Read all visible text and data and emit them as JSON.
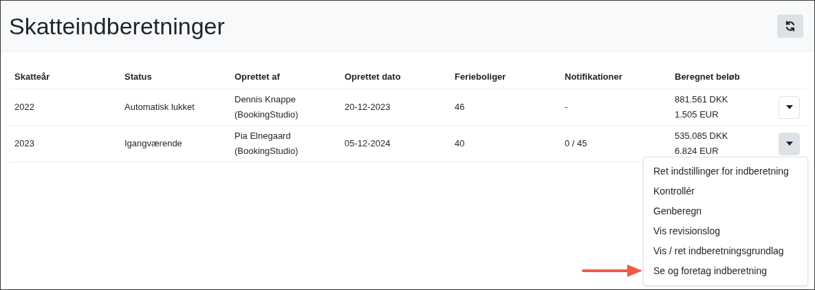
{
  "header": {
    "title": "Skatteindberetninger"
  },
  "table": {
    "columns": [
      "Skatteår",
      "Status",
      "Oprettet af",
      "Oprettet dato",
      "Ferieboliger",
      "Notifikationer",
      "Beregnet beløb"
    ],
    "rows": [
      {
        "cells": [
          "2022",
          "Automatisk lukket",
          [
            "Dennis Knappe",
            "(BookingStudio)"
          ],
          "20-12-2023",
          "46",
          "-",
          [
            "881.561 DKK",
            "1.505 EUR"
          ]
        ],
        "menu_open": false
      },
      {
        "cells": [
          "2023",
          "Igangværende",
          [
            "Pia Elnegaard",
            "(BookingStudio)"
          ],
          "05-12-2024",
          "40",
          "0 / 45",
          [
            "535.085 DKK",
            "6.824 EUR"
          ]
        ],
        "menu_open": true
      }
    ]
  },
  "menu": {
    "items": [
      {
        "label": "Ret indstillinger for indberetning",
        "arrow_pointed": false
      },
      {
        "label": "Kontrollér",
        "arrow_pointed": false
      },
      {
        "label": "Genberegn",
        "arrow_pointed": false
      },
      {
        "label": "Vis revisionslog",
        "arrow_pointed": false
      },
      {
        "label": "Vis / ret indberetningsgrundlag",
        "arrow_pointed": false
      },
      {
        "label": "Se og foretag indberetning",
        "arrow_pointed": true
      }
    ]
  }
}
